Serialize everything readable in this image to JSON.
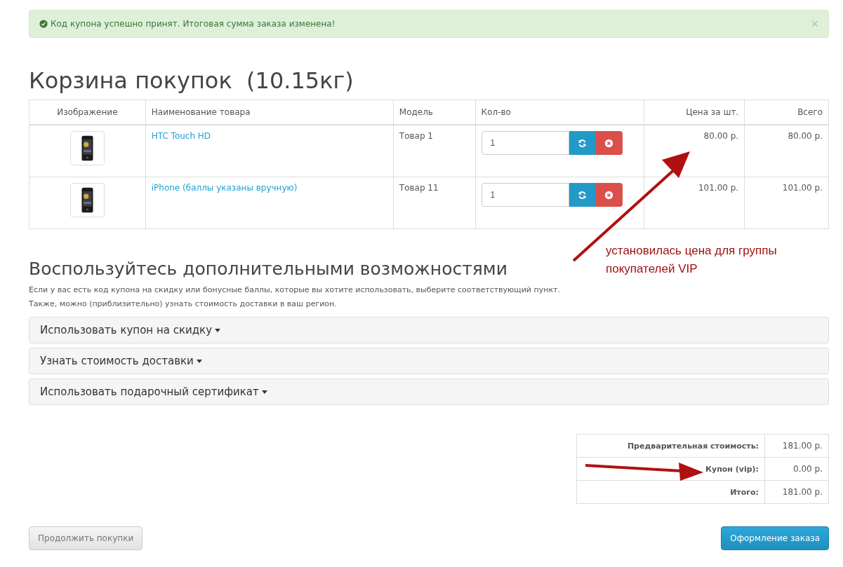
{
  "alert": {
    "text": "Код купона успешно принят. Итоговая сумма заказа изменена!",
    "close": "×"
  },
  "title": "Корзина покупок  (10.15кг)",
  "cart": {
    "columns": [
      "Изображение",
      "Наименование товара",
      "Модель",
      "Кол-во",
      "Цена за шт.",
      "Всего"
    ],
    "rows": [
      {
        "name": "HTC Touch HD",
        "model": "Товар 1",
        "quantity": "1",
        "price": "80.00 р.",
        "total": "80.00 р."
      },
      {
        "name": "iPhone (баллы указаны вручную)",
        "model": "Товар 11",
        "quantity": "1",
        "price": "101.00 р.",
        "total": "101.00 р."
      }
    ]
  },
  "extras": {
    "heading": "Воспользуйтесь дополнительными возможностями",
    "text": [
      "Если у вас есть код купона на скидку или бонусные баллы, которые вы хотите использовать, выберите соответствующий пункт.",
      "Также, можно (приблизительно) узнать стоимость доставки в ваш регион."
    ],
    "panels": [
      {
        "label": "Использовать купон на скидку",
        "expanded": false
      },
      {
        "label": "Узнать стоимость доставки",
        "expanded": false
      },
      {
        "label": "Использовать подарочный сертификат",
        "expanded": false
      }
    ]
  },
  "totals": [
    {
      "label": "Предварительная стоимость:",
      "value": "181.00 р."
    },
    {
      "label": "Купон (vip):",
      "value": "0.00 р."
    },
    {
      "label": "Итого:",
      "value": "181.00 р."
    }
  ],
  "buttons": {
    "continue": "Продолжить покупки",
    "checkout": "Оформление заказа"
  },
  "annotation": {
    "text": "установилась цена для группы покупателей VIP"
  }
}
